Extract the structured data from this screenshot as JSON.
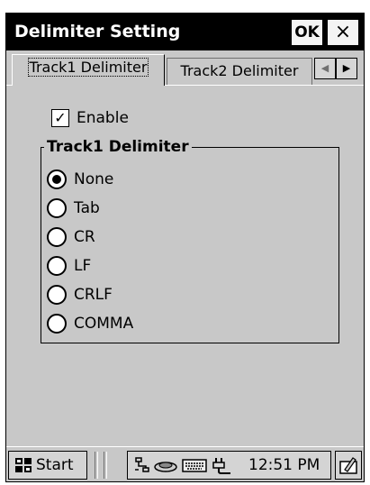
{
  "window": {
    "title": "Delimiter Setting",
    "ok_label": "OK",
    "close_label": "×"
  },
  "tabs": [
    {
      "label": "Track1 Delimiter",
      "active": true
    },
    {
      "label": "Track2 Delimiter",
      "active": false
    }
  ],
  "tab_scroll": {
    "left_glyph": "◀",
    "right_glyph": "▶"
  },
  "enable": {
    "label": "Enable",
    "checked": true,
    "check_glyph": "✓"
  },
  "group": {
    "title": "Track1 Delimiter",
    "options": [
      {
        "label": "None",
        "selected": true
      },
      {
        "label": "Tab",
        "selected": false
      },
      {
        "label": "CR",
        "selected": false
      },
      {
        "label": "LF",
        "selected": false
      },
      {
        "label": "CRLF",
        "selected": false
      },
      {
        "label": "COMMA",
        "selected": false
      }
    ]
  },
  "taskbar": {
    "start_label": "Start",
    "clock": "12:51 PM",
    "tray_icons": [
      "network-icon",
      "connectivity-icon",
      "keyboard-icon",
      "power-icon"
    ],
    "sip_icon": "input-panel-icon"
  }
}
